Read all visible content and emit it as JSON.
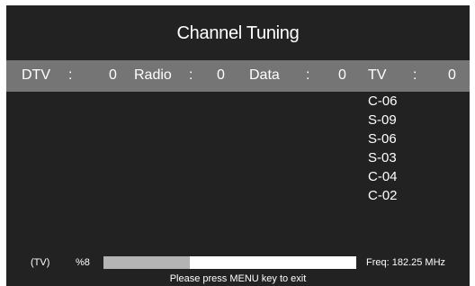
{
  "title": "Channel Tuning",
  "counts": [
    {
      "label": "DTV",
      "sep": ":",
      "value": "0"
    },
    {
      "label": "Radio",
      "sep": ":",
      "value": "0"
    },
    {
      "label": "Data",
      "sep": ":",
      "value": "0"
    },
    {
      "label": "TV",
      "sep": ":",
      "value": "0"
    }
  ],
  "channels": [
    "C-06",
    "S-09",
    "S-06",
    "S-03",
    "C-04",
    "C-02"
  ],
  "status": {
    "mode": "(TV)",
    "percent_text": "%8",
    "progress_fraction": 0.34,
    "freq": "Freq: 182.25 MHz"
  },
  "hint": "Please press MENU key to exit",
  "colors": {
    "background": "#222222",
    "bar": "#757575",
    "progress_fill": "#b4b4b4",
    "progress_track": "#ffffff"
  }
}
